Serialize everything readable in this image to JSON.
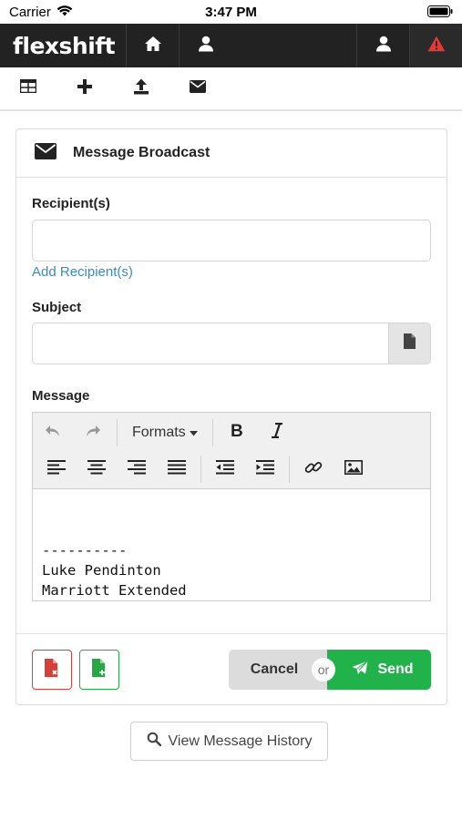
{
  "status_bar": {
    "carrier": "Carrier",
    "time": "3:47 PM"
  },
  "navbar": {
    "brand": "flexshift",
    "icons": [
      "home-icon",
      "user-icon",
      "user-icon",
      "warning-icon"
    ],
    "colors": {
      "background": "#222222",
      "alert": "#e53935"
    }
  },
  "toolbar": {
    "icons": [
      "table-icon",
      "plus-icon",
      "upload-icon",
      "envelope-icon"
    ]
  },
  "panel": {
    "title": "Message Broadcast",
    "recipients": {
      "label": "Recipient(s)",
      "value": "",
      "add_link": "Add Recipient(s)"
    },
    "subject": {
      "label": "Subject",
      "value": ""
    },
    "message": {
      "label": "Message",
      "formats_label": "Formats",
      "body_lines": [
        "----------",
        "Luke Pendinton",
        "Marriott Extended"
      ]
    },
    "footer": {
      "cancel_label": "Cancel",
      "or_label": "or",
      "send_label": "Send"
    }
  },
  "history_button": {
    "label": "View Message History"
  },
  "colors": {
    "link": "#3b8ac4",
    "send": "#22b24c",
    "danger": "#d43f3a",
    "success": "#28a745"
  }
}
